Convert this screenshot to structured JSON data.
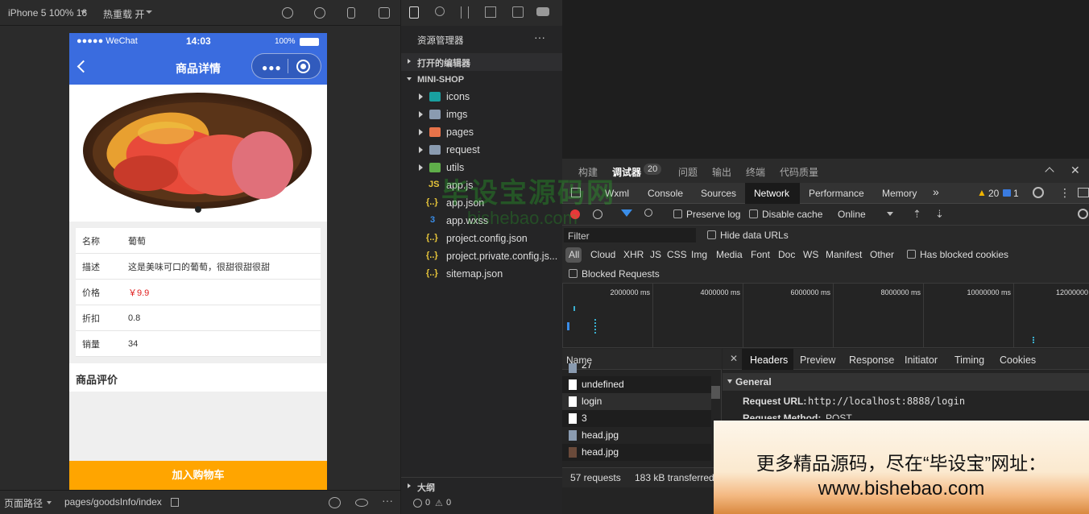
{
  "toolbar": {
    "device": "iPhone 5 100% 16",
    "hot_reload": "热重载 开"
  },
  "phone": {
    "carrier": "●●●●● WeChat",
    "time": "14:03",
    "battery": "100%",
    "nav_title": "商品详情",
    "info": [
      {
        "key": "名称",
        "value": "葡萄"
      },
      {
        "key": "描述",
        "value": "这是美味可口的葡萄，很甜很甜很甜"
      },
      {
        "key": "价格",
        "value": "￥9.9"
      },
      {
        "key": "折扣",
        "value": "0.8"
      },
      {
        "key": "销量",
        "value": "34"
      }
    ],
    "review_title": "商品评价",
    "cart_button": "加入购物车",
    "price_color": "#e02020",
    "nav_color": "#3a6cdf",
    "cart_color": "#ffa500"
  },
  "bottombar": {
    "path_label": "页面路径",
    "path": "pages/goodsInfo/index"
  },
  "explorer": {
    "title": "资源管理器",
    "open_editors": "打开的编辑器",
    "project": "MINI-SHOP",
    "items": [
      {
        "name": "icons",
        "type": "folder",
        "icon_color": "#19a0a0"
      },
      {
        "name": "imgs",
        "type": "folder",
        "icon_color": "#8a9bb0"
      },
      {
        "name": "pages",
        "type": "folder",
        "icon_color": "#e8734a"
      },
      {
        "name": "request",
        "type": "folder",
        "icon_color": "#8a9bb0"
      },
      {
        "name": "utils",
        "type": "folder",
        "icon_color": "#5fae4a"
      },
      {
        "name": "app.js",
        "type": "file",
        "glyph": "JS",
        "glyph_color": "#e8c63a"
      },
      {
        "name": "app.json",
        "type": "file",
        "glyph": "{..}",
        "glyph_color": "#e8c63a"
      },
      {
        "name": "app.wxss",
        "type": "file",
        "glyph": "3",
        "glyph_color": "#3a8de8"
      },
      {
        "name": "project.config.json",
        "type": "file",
        "glyph": "{..}",
        "glyph_color": "#e8c63a"
      },
      {
        "name": "project.private.config.js...",
        "type": "file",
        "glyph": "{..}",
        "glyph_color": "#e8c63a"
      },
      {
        "name": "sitemap.json",
        "type": "file",
        "glyph": "{..}",
        "glyph_color": "#e8c63a"
      }
    ],
    "outline": "大纲",
    "errors": "0",
    "warnings": "0"
  },
  "devtools": {
    "top_tabs": [
      "构建",
      "调试器",
      "问题",
      "输出",
      "终端",
      "代码质量"
    ],
    "badge": "20",
    "tabs": [
      "Wxml",
      "Console",
      "Sources",
      "Network",
      "Performance",
      "Memory"
    ],
    "warn_count": "20",
    "info_count": "1",
    "preserve_log": "Preserve log",
    "disable_cache": "Disable cache",
    "throttle": "Online",
    "filter_placeholder": "Filter",
    "hide_data_urls": "Hide data URLs",
    "types": [
      "All",
      "Cloud",
      "XHR",
      "JS",
      "CSS",
      "Img",
      "Media",
      "Font",
      "Doc",
      "WS",
      "Manifest",
      "Other"
    ],
    "has_blocked_cookies": "Has blocked cookies",
    "blocked_requests": "Blocked Requests",
    "timeline_ticks": [
      "2000000 ms",
      "4000000 ms",
      "6000000 ms",
      "8000000 ms",
      "10000000 ms",
      "12000000"
    ],
    "name_header": "Name",
    "requests": [
      "27",
      "undefined",
      "login",
      "3",
      "head.jpg",
      "head.jpg"
    ],
    "summary_requests": "57 requests",
    "summary_transferred": "183 kB transferred",
    "detail_tabs": [
      "Headers",
      "Preview",
      "Response",
      "Initiator",
      "Timing",
      "Cookies"
    ],
    "general_label": "General",
    "request_url_label": "Request URL:",
    "request_url": "http://localhost:8888/login",
    "request_method_label": "Request Method:",
    "request_method": "POST"
  },
  "watermark": {
    "overlay_text": "毕设宝源码网",
    "overlay_url": "bishebao.com",
    "banner_line1": "更多精品源码，尽在“毕设宝”网址：",
    "banner_line2": "www.bishebao.com"
  }
}
